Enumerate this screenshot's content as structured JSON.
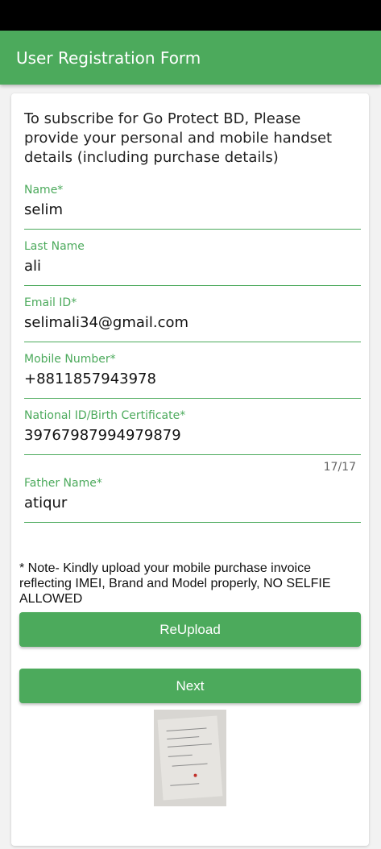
{
  "app_bar": {
    "title": "User Registration Form"
  },
  "form": {
    "intro": "To subscribe for Go Protect BD, Please provide your personal and mobile handset details (including purchase details)",
    "fields": [
      {
        "label": "Name*",
        "value": "selim"
      },
      {
        "label": "Last Name",
        "value": "ali"
      },
      {
        "label": "Email ID*",
        "value": "selimali34@gmail.com"
      },
      {
        "label": "Mobile Number*",
        "value": "+8811857943978"
      },
      {
        "label": "National ID/Birth Certificate*",
        "value": "39767987994979879"
      },
      {
        "label": "Father Name*",
        "value": "atiqur"
      }
    ],
    "nid_counter": "17/17",
    "note": "* Note- Kindly upload your mobile purchase invoice reflecting IMEI, Brand and Model properly, NO SELFIE ALLOWED",
    "reupload_label": "ReUpload",
    "next_label": "Next"
  },
  "colors": {
    "accent": "#4caa5c",
    "status_bar": "#000000",
    "card": "#ffffff"
  },
  "icons": {
    "invoice_thumbnail": "invoice-photo"
  }
}
